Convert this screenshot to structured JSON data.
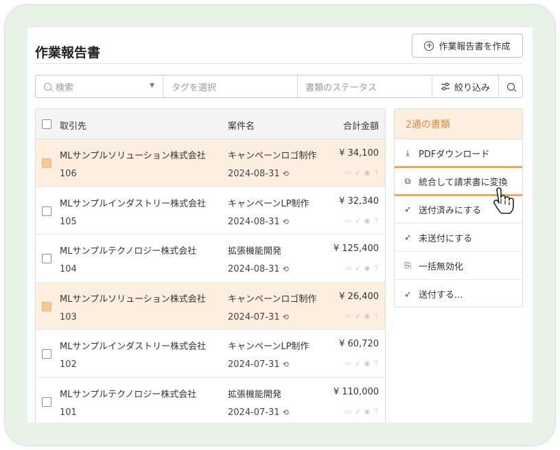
{
  "page": {
    "title": "作業報告書",
    "create_button": "作業報告書を作成"
  },
  "filters": {
    "search_placeholder": "検索",
    "tag_placeholder": "タグを選択",
    "status_placeholder": "書類のステータス",
    "filter_label": "絞り込み"
  },
  "table": {
    "headers": {
      "client": "取引先",
      "name": "案件名",
      "amount": "合計金額"
    },
    "rows": [
      {
        "client": "MLサンプルソリューション株式会社",
        "id": "106",
        "name": "キャンペーンロゴ制作",
        "date": "2024-08-31",
        "amount": "¥ 34,100",
        "selected": true
      },
      {
        "client": "MLサンプルインダストリー株式会社",
        "id": "105",
        "name": "キャンペーンLP制作",
        "date": "2024-08-31",
        "amount": "¥ 32,340",
        "selected": false
      },
      {
        "client": "MLサンプルテクノロジー株式会社",
        "id": "104",
        "name": "拡張機能開発",
        "date": "2024-08-31",
        "amount": "¥ 125,400",
        "selected": false
      },
      {
        "client": "MLサンプルソリューション株式会社",
        "id": "103",
        "name": "キャンペーンロゴ制作",
        "date": "2024-07-31",
        "amount": "¥ 26,400",
        "selected": true
      },
      {
        "client": "MLサンプルインダストリー株式会社",
        "id": "102",
        "name": "キャンペーンLP制作",
        "date": "2024-07-31",
        "amount": "¥ 60,720",
        "selected": false
      },
      {
        "client": "MLサンプルテクノロジー株式会社",
        "id": "101",
        "name": "拡張機能開発",
        "date": "2024-07-31",
        "amount": "¥ 110,000",
        "selected": false
      }
    ]
  },
  "panel": {
    "header": "2通の書類",
    "items": [
      {
        "label": "PDFダウンロード",
        "icon": "download-icon"
      },
      {
        "label": "統合して請求書に変換",
        "icon": "copy-icon",
        "highlighted": true
      },
      {
        "label": "送付済みにする",
        "icon": "send-icon"
      },
      {
        "label": "未送付にする",
        "icon": "send-icon"
      },
      {
        "label": "一括無効化",
        "icon": "document-x-icon"
      },
      {
        "label": "送付する...",
        "icon": "send-icon"
      }
    ]
  },
  "colors": {
    "accent": "#d88a3a",
    "selected_row": "#fdefe0",
    "highlight_border": "#f2a64e"
  }
}
